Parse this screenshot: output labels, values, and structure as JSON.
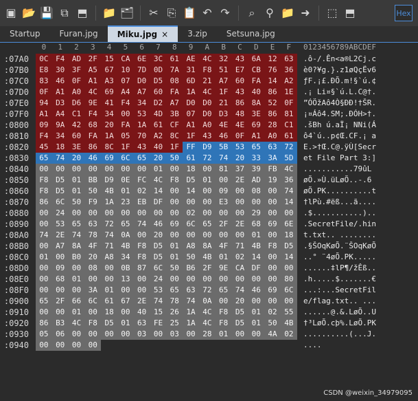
{
  "toolbar": {
    "icons": [
      "new-file-icon",
      "open-folder-icon",
      "save-icon",
      "save-copy-icon",
      "save-all-icon",
      "folder-icon",
      "folder-open-icon",
      "cut-icon",
      "copy-icon",
      "paste-icon",
      "undo-icon",
      "redo-icon",
      "search-icon",
      "search-replace-icon",
      "find-folder-icon",
      "arrow-right-icon",
      "bookmark-icon",
      "bookmark-prev-icon"
    ],
    "hex_label": "Hex"
  },
  "tabs": [
    {
      "label": "Startup"
    },
    {
      "label": "Furan.jpg"
    },
    {
      "label": "Miku.jpg",
      "active": true,
      "close": "×"
    },
    {
      "label": "3.zip"
    },
    {
      "label": "Setsuna.jpg"
    }
  ],
  "hex_header": [
    "0",
    "1",
    "2",
    "3",
    "4",
    "5",
    "6",
    "7",
    "8",
    "9",
    "A",
    "B",
    "C",
    "D",
    "E",
    "F"
  ],
  "ascii_header": "0123456789ABCDEF",
  "rows": [
    {
      "offset": ":07A0",
      "bytes": [
        "0C",
        "F4",
        "AD",
        "2F",
        "15",
        "CA",
        "6E",
        "3C",
        "61",
        "AE",
        "4C",
        "32",
        "43",
        "6A",
        "12",
        "63"
      ],
      "classes": [
        "red",
        "red",
        "red",
        "red",
        "red",
        "red",
        "red",
        "red",
        "red",
        "red",
        "red",
        "red",
        "red",
        "red",
        "red",
        "red"
      ],
      "ascii": ".ô-/.Ên<a®L2Cj.c"
    },
    {
      "offset": ":07B0",
      "bytes": [
        "E8",
        "30",
        "3F",
        "A5",
        "67",
        "10",
        "7D",
        "0D",
        "7A",
        "31",
        "F8",
        "51",
        "E7",
        "CB",
        "76",
        "36"
      ],
      "classes": [
        "red",
        "red",
        "red",
        "red",
        "red",
        "red",
        "red",
        "red",
        "red",
        "red",
        "red",
        "red",
        "red",
        "red",
        "red",
        "red"
      ],
      "ascii": "è0?¥g.}.z1øQçËv6"
    },
    {
      "offset": ":07C0",
      "bytes": [
        "83",
        "46",
        "0F",
        "A1",
        "A3",
        "07",
        "D0",
        "D5",
        "08",
        "6D",
        "21",
        "A7",
        "60",
        "FA",
        "14",
        "A2"
      ],
      "classes": [
        "red",
        "red",
        "red",
        "red",
        "red",
        "red",
        "red",
        "red",
        "red",
        "red",
        "red",
        "red",
        "red",
        "red",
        "red",
        "red"
      ],
      "ascii": "ƒF.¡£.ÐÕ.m!§`ú.¢"
    },
    {
      "offset": ":07D0",
      "bytes": [
        "0F",
        "A1",
        "A0",
        "4C",
        "69",
        "A4",
        "A7",
        "60",
        "FA",
        "1A",
        "4C",
        "1F",
        "43",
        "40",
        "86",
        "1E"
      ],
      "classes": [
        "red",
        "red",
        "red",
        "red",
        "red",
        "red",
        "red",
        "red",
        "red",
        "red",
        "red",
        "red",
        "red",
        "red",
        "red",
        "red"
      ],
      "ascii": ".¡ Li¤§`ú.L.C@†."
    },
    {
      "offset": ":07E0",
      "bytes": [
        "94",
        "D3",
        "D6",
        "9E",
        "41",
        "F4",
        "34",
        "D2",
        "A7",
        "D0",
        "D0",
        "21",
        "86",
        "8A",
        "52",
        "0F"
      ],
      "classes": [
        "red",
        "red",
        "red",
        "red",
        "red",
        "red",
        "red",
        "red",
        "red",
        "red",
        "red",
        "red",
        "red",
        "red",
        "red",
        "red"
      ],
      "ascii": "”ÓÖžAô4Ò§ÐÐ!†ŠR."
    },
    {
      "offset": ":07F0",
      "bytes": [
        "A1",
        "A4",
        "C1",
        "F4",
        "34",
        "00",
        "53",
        "4D",
        "3B",
        "07",
        "D0",
        "D3",
        "48",
        "3E",
        "86",
        "81"
      ],
      "classes": [
        "red",
        "red",
        "red",
        "red",
        "red",
        "red",
        "red",
        "red",
        "red",
        "red",
        "red",
        "red",
        "red",
        "red",
        "red",
        "red"
      ],
      "ascii": "¡¤Áô4.SM;.ÐÓH>†."
    },
    {
      "offset": ":0800",
      "bytes": [
        "09",
        "9A",
        "42",
        "68",
        "20",
        "FA",
        "1A",
        "61",
        "CF",
        "A1",
        "A0",
        "4E",
        "4E",
        "69",
        "28",
        "C1"
      ],
      "classes": [
        "red",
        "red",
        "red",
        "red",
        "red",
        "red",
        "red",
        "red",
        "red",
        "red",
        "red",
        "red",
        "red",
        "red",
        "red",
        "red"
      ],
      "ascii": ".šBh ú.aÏ¡ NNi(Á"
    },
    {
      "offset": ":0810",
      "bytes": [
        "F4",
        "34",
        "60",
        "FA",
        "1A",
        "05",
        "70",
        "A2",
        "8C",
        "1F",
        "43",
        "46",
        "0F",
        "A1",
        "A0",
        "61"
      ],
      "classes": [
        "red",
        "red",
        "red",
        "red",
        "red",
        "red",
        "red",
        "red",
        "red",
        "red",
        "red",
        "red",
        "red",
        "red",
        "red",
        "red"
      ],
      "ascii": "ô4`ú..p¢Œ.CF.¡ a"
    },
    {
      "offset": ":0820",
      "bytes": [
        "45",
        "18",
        "3E",
        "86",
        "8C",
        "1F",
        "43",
        "40",
        "1F",
        "FF",
        "D9",
        "5B",
        "53",
        "65",
        "63",
        "72"
      ],
      "classes": [
        "red",
        "red",
        "red",
        "red",
        "red",
        "red",
        "red",
        "red",
        "red",
        "blue",
        "blue",
        "blue",
        "blue",
        "blue",
        "blue",
        "blue"
      ],
      "ascii": "E.>†Œ.C@.ÿÙ[Secr"
    },
    {
      "offset": ":0830",
      "bytes": [
        "65",
        "74",
        "20",
        "46",
        "69",
        "6C",
        "65",
        "20",
        "50",
        "61",
        "72",
        "74",
        "20",
        "33",
        "3A",
        "5D"
      ],
      "classes": [
        "blue",
        "blue",
        "blue",
        "blue",
        "blue",
        "blue",
        "blue",
        "blue",
        "blue",
        "blue",
        "blue",
        "blue",
        "blue",
        "blue",
        "blue",
        "blue"
      ],
      "ascii": "et File Part 3:]"
    },
    {
      "offset": ":0840",
      "bytes": [
        "00",
        "00",
        "00",
        "00",
        "00",
        "00",
        "00",
        "01",
        "00",
        "18",
        "00",
        "81",
        "37",
        "39",
        "FB",
        "4C"
      ],
      "classes": [
        "gray",
        "gray",
        "gray",
        "gray",
        "gray",
        "gray",
        "gray",
        "gray",
        "gray",
        "gray",
        "gray",
        "gray",
        "gray",
        "gray",
        "gray",
        "gray"
      ],
      "ascii": "...........79ûL"
    },
    {
      "offset": ":0850",
      "bytes": [
        "F8",
        "D5",
        "01",
        "BB",
        "D9",
        "0E",
        "FC",
        "4C",
        "F8",
        "D5",
        "01",
        "00",
        "2E",
        "AD",
        "19",
        "36"
      ],
      "classes": [
        "gray",
        "gray",
        "gray",
        "gray",
        "gray",
        "gray",
        "gray",
        "gray",
        "gray",
        "gray",
        "gray",
        "gray",
        "gray",
        "gray",
        "gray",
        "gray"
      ],
      "ascii": "øÕ.»Ù.üLøÕ..-.6"
    },
    {
      "offset": ":0860",
      "bytes": [
        "F8",
        "D5",
        "01",
        "50",
        "4B",
        "01",
        "02",
        "14",
        "00",
        "14",
        "00",
        "09",
        "00",
        "08",
        "00",
        "74"
      ],
      "classes": [
        "gray",
        "gray",
        "gray",
        "gray",
        "gray",
        "gray",
        "gray",
        "gray",
        "gray",
        "gray",
        "gray",
        "gray",
        "gray",
        "gray",
        "gray",
        "gray"
      ],
      "ascii": "øÕ.PK..........t"
    },
    {
      "offset": ":0870",
      "bytes": [
        "86",
        "6C",
        "50",
        "F9",
        "1A",
        "23",
        "EB",
        "DF",
        "00",
        "00",
        "00",
        "E3",
        "00",
        "00",
        "00",
        "14"
      ],
      "classes": [
        "gray",
        "gray",
        "gray",
        "gray",
        "gray",
        "gray",
        "gray",
        "gray",
        "gray",
        "gray",
        "gray",
        "gray",
        "gray",
        "gray",
        "gray",
        "gray"
      ],
      "ascii": "†lPù.#ëß...ã...."
    },
    {
      "offset": ":0880",
      "bytes": [
        "00",
        "24",
        "00",
        "00",
        "00",
        "00",
        "00",
        "00",
        "00",
        "02",
        "00",
        "00",
        "00",
        "29",
        "00",
        "00"
      ],
      "classes": [
        "gray",
        "gray",
        "gray",
        "gray",
        "gray",
        "gray",
        "gray",
        "gray",
        "gray",
        "gray",
        "gray",
        "gray",
        "gray",
        "gray",
        "gray",
        "gray"
      ],
      "ascii": ".$...........).."
    },
    {
      "offset": ":0890",
      "bytes": [
        "00",
        "53",
        "65",
        "63",
        "72",
        "65",
        "74",
        "46",
        "69",
        "6C",
        "65",
        "2F",
        "2E",
        "68",
        "69",
        "6E"
      ],
      "classes": [
        "gray",
        "gray",
        "gray",
        "gray",
        "gray",
        "gray",
        "gray",
        "gray",
        "gray",
        "gray",
        "gray",
        "gray",
        "gray",
        "gray",
        "gray",
        "gray"
      ],
      "ascii": ".SecretFile/.hin"
    },
    {
      "offset": ":08A0",
      "bytes": [
        "74",
        "2E",
        "74",
        "78",
        "74",
        "0A",
        "00",
        "20",
        "00",
        "00",
        "00",
        "00",
        "00",
        "01",
        "00",
        "18"
      ],
      "classes": [
        "gray",
        "gray",
        "gray",
        "gray",
        "gray",
        "gray",
        "gray",
        "gray",
        "gray",
        "gray",
        "gray",
        "gray",
        "gray",
        "gray",
        "gray",
        "gray"
      ],
      "ascii": "t.txt.. ........"
    },
    {
      "offset": ":08B0",
      "bytes": [
        "00",
        "A7",
        "8A",
        "4F",
        "71",
        "4B",
        "F8",
        "D5",
        "01",
        "A8",
        "8A",
        "4F",
        "71",
        "4B",
        "F8",
        "D5"
      ],
      "classes": [
        "gray",
        "gray",
        "gray",
        "gray",
        "gray",
        "gray",
        "gray",
        "gray",
        "gray",
        "gray",
        "gray",
        "gray",
        "gray",
        "gray",
        "gray",
        "gray"
      ],
      "ascii": ".§ŠOqKøÕ.¨ŠOqKøÕ"
    },
    {
      "offset": ":08C0",
      "bytes": [
        "01",
        "00",
        "B0",
        "20",
        "A8",
        "34",
        "F8",
        "D5",
        "01",
        "50",
        "4B",
        "01",
        "02",
        "14",
        "00",
        "14"
      ],
      "classes": [
        "gray",
        "gray",
        "gray",
        "gray",
        "gray",
        "gray",
        "gray",
        "gray",
        "gray",
        "gray",
        "gray",
        "gray",
        "gray",
        "gray",
        "gray",
        "gray"
      ],
      "ascii": "..° ¨4øÕ.PK....."
    },
    {
      "offset": ":08D0",
      "bytes": [
        "00",
        "09",
        "00",
        "08",
        "00",
        "0B",
        "87",
        "6C",
        "50",
        "B6",
        "2F",
        "9E",
        "CA",
        "DF",
        "00",
        "00"
      ],
      "classes": [
        "gray",
        "gray",
        "gray",
        "gray",
        "gray",
        "gray",
        "gray",
        "gray",
        "gray",
        "gray",
        "gray",
        "gray",
        "gray",
        "gray",
        "gray",
        "gray"
      ],
      "ascii": "......‡lP¶/žÊß.."
    },
    {
      "offset": ":08E0",
      "bytes": [
        "00",
        "68",
        "01",
        "00",
        "00",
        "13",
        "00",
        "24",
        "00",
        "00",
        "00",
        "00",
        "00",
        "00",
        "00",
        "80"
      ],
      "classes": [
        "gray",
        "gray",
        "gray",
        "gray",
        "gray",
        "gray",
        "gray",
        "gray",
        "gray",
        "gray",
        "gray",
        "gray",
        "gray",
        "gray",
        "gray",
        "gray"
      ],
      "ascii": ".h.....$.......€"
    },
    {
      "offset": ":08F0",
      "bytes": [
        "00",
        "00",
        "00",
        "3A",
        "01",
        "00",
        "00",
        "53",
        "65",
        "63",
        "72",
        "65",
        "74",
        "46",
        "69",
        "6C"
      ],
      "classes": [
        "gray",
        "gray",
        "gray",
        "gray",
        "gray",
        "gray",
        "gray",
        "gray",
        "gray",
        "gray",
        "gray",
        "gray",
        "gray",
        "gray",
        "gray",
        "gray"
      ],
      "ascii": "...:...SecretFil"
    },
    {
      "offset": ":0900",
      "bytes": [
        "65",
        "2F",
        "66",
        "6C",
        "61",
        "67",
        "2E",
        "74",
        "78",
        "74",
        "0A",
        "00",
        "20",
        "00",
        "00",
        "00"
      ],
      "classes": [
        "gray",
        "gray",
        "gray",
        "gray",
        "gray",
        "gray",
        "gray",
        "gray",
        "gray",
        "gray",
        "gray",
        "gray",
        "gray",
        "gray",
        "gray",
        "gray"
      ],
      "ascii": "e/flag.txt.. ..."
    },
    {
      "offset": ":0910",
      "bytes": [
        "00",
        "00",
        "01",
        "00",
        "18",
        "00",
        "40",
        "15",
        "26",
        "1A",
        "4C",
        "F8",
        "D5",
        "01",
        "02",
        "55"
      ],
      "classes": [
        "gray",
        "gray",
        "gray",
        "gray",
        "gray",
        "gray",
        "gray",
        "gray",
        "gray",
        "gray",
        "gray",
        "gray",
        "gray",
        "gray",
        "gray",
        "gray"
      ],
      "ascii": "......@.&.LøÕ..U"
    },
    {
      "offset": ":0920",
      "bytes": [
        "86",
        "B3",
        "4C",
        "F8",
        "D5",
        "01",
        "63",
        "FE",
        "25",
        "1A",
        "4C",
        "F8",
        "D5",
        "01",
        "50",
        "4B"
      ],
      "classes": [
        "gray",
        "gray",
        "gray",
        "gray",
        "gray",
        "gray",
        "gray",
        "gray",
        "gray",
        "gray",
        "gray",
        "gray",
        "gray",
        "gray",
        "gray",
        "gray"
      ],
      "ascii": "†³LøÕ.cþ%.LøÕ.PK"
    },
    {
      "offset": ":0930",
      "bytes": [
        "05",
        "06",
        "00",
        "00",
        "00",
        "00",
        "03",
        "00",
        "03",
        "00",
        "28",
        "01",
        "00",
        "00",
        "4A",
        "02"
      ],
      "classes": [
        "gray",
        "gray",
        "gray",
        "gray",
        "gray",
        "gray",
        "gray",
        "gray",
        "gray",
        "gray",
        "gray",
        "gray",
        "gray",
        "gray",
        "gray",
        "gray"
      ],
      "ascii": "..........(...J."
    },
    {
      "offset": ":0940",
      "bytes": [
        "00",
        "00",
        "00",
        "00",
        "",
        "",
        "",
        "",
        "",
        "",
        "",
        "",
        "",
        "",
        "",
        ""
      ],
      "classes": [
        "gray",
        "gray",
        "gray",
        "gray",
        "empty",
        "empty",
        "empty",
        "empty",
        "empty",
        "empty",
        "empty",
        "empty",
        "empty",
        "empty",
        "empty",
        "empty"
      ],
      "ascii": "...."
    }
  ],
  "watermark": "CSDN @weixin_34979095"
}
